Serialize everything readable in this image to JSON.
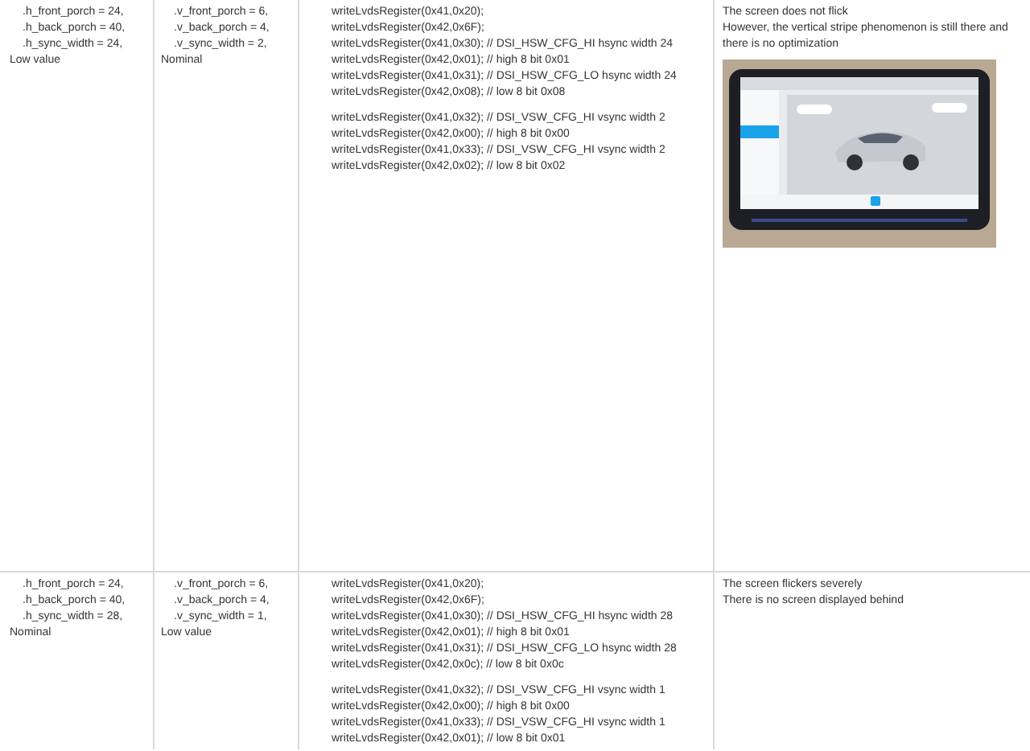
{
  "table": {
    "rows": [
      {
        "h_params": {
          "lines": [
            ".h_front_porch = 24,",
            ".h_back_porch = 40,",
            ".h_sync_width = 24,"
          ],
          "label": "Low value"
        },
        "v_params": {
          "lines": [
            ".v_front_porch = 6,",
            ".v_back_porch = 4,",
            ".v_sync_width = 2,"
          ],
          "label": "Nominal"
        },
        "code": {
          "groups": [
            [
              "writeLvdsRegister(0x41,0x20);",
              "writeLvdsRegister(0x42,0x6F);",
              "writeLvdsRegister(0x41,0x30); // DSI_HSW_CFG_HI hsync width 24",
              "writeLvdsRegister(0x42,0x01); // high 8 bit 0x01",
              "writeLvdsRegister(0x41,0x31); // DSI_HSW_CFG_LO hsync width 24",
              "writeLvdsRegister(0x42,0x08); // low 8 bit 0x08"
            ],
            [
              "writeLvdsRegister(0x41,0x32); // DSI_VSW_CFG_HI vsync width 2",
              "writeLvdsRegister(0x42,0x00); // high 8 bit 0x00",
              "writeLvdsRegister(0x41,0x33); // DSI_VSW_CFG_HI vsync width 2",
              "writeLvdsRegister(0x42,0x02); // low 8 bit 0x02"
            ]
          ]
        },
        "result": {
          "lines": [
            "The screen does not flick",
            "However, the vertical stripe phenomenon is still there and there is no optimization"
          ],
          "photo": {
            "kind": "picture"
          }
        }
      },
      {
        "h_params": {
          "lines": [
            ".h_front_porch = 24,",
            ".h_back_porch = 40,",
            ".h_sync_width = 28,"
          ],
          "label": "Nominal"
        },
        "v_params": {
          "lines": [
            ".v_front_porch = 6,",
            ".v_back_porch = 4,",
            ".v_sync_width = 1,"
          ],
          "label": "Low value"
        },
        "code": {
          "groups": [
            [
              "writeLvdsRegister(0x41,0x20);",
              "writeLvdsRegister(0x42,0x6F);",
              "writeLvdsRegister(0x41,0x30); // DSI_HSW_CFG_HI hsync width 28",
              "writeLvdsRegister(0x42,0x01); // high 8 bit 0x01",
              "writeLvdsRegister(0x41,0x31); // DSI_HSW_CFG_LO hsync width 28",
              "writeLvdsRegister(0x42,0x0c); // low 8 bit 0x0c"
            ],
            [
              "writeLvdsRegister(0x41,0x32); // DSI_VSW_CFG_HI vsync width 1",
              "writeLvdsRegister(0x42,0x00); // high 8 bit 0x00",
              "writeLvdsRegister(0x41,0x33); // DSI_VSW_CFG_HI vsync width 1",
              "writeLvdsRegister(0x42,0x01); // low 8 bit 0x01"
            ]
          ]
        },
        "result": {
          "lines": [
            "The screen flickers severely",
            "There is no screen displayed behind"
          ]
        }
      }
    ]
  }
}
